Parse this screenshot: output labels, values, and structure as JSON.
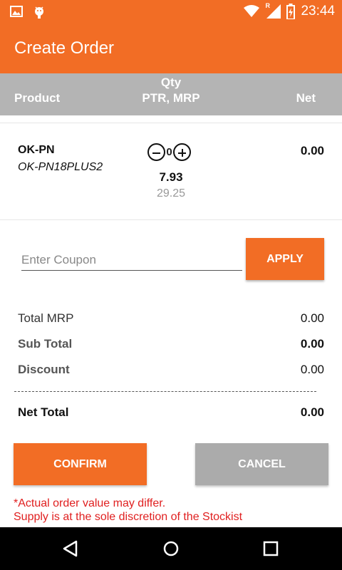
{
  "status_bar": {
    "time": "23:44",
    "icons": [
      "image-icon",
      "android-icon",
      "wifi-icon",
      "signal-icon",
      "battery-charging-icon"
    ],
    "roaming_label": "R"
  },
  "app_bar": {
    "title": "Create Order",
    "color": "#f26d25"
  },
  "table_header": {
    "product": "Product",
    "qty": "Qty",
    "ptr_mrp": "PTR, MRP",
    "net": "Net"
  },
  "items": [
    {
      "name": "OK-PN",
      "code": "OK-PN18PLUS2",
      "qty": "0",
      "ptr": "7.93",
      "mrp": "29.25",
      "net": "0.00"
    }
  ],
  "coupon": {
    "placeholder": "Enter Coupon",
    "value": "",
    "apply_label": "APPLY"
  },
  "summary": {
    "total_mrp_label": "Total MRP",
    "total_mrp": "0.00",
    "sub_total_label": "Sub Total",
    "sub_total": "0.00",
    "discount_label": "Discount",
    "discount": "0.00",
    "net_total_label": "Net Total",
    "net_total": "0.00"
  },
  "actions": {
    "confirm_label": "CONFIRM",
    "cancel_label": "CANCEL"
  },
  "notes": {
    "line1": "*Actual order value may differ.",
    "line2": "Supply is at the sole discretion of the Stockist"
  },
  "nav_bar": {
    "icons": [
      "back-icon",
      "home-icon",
      "recents-icon"
    ]
  }
}
